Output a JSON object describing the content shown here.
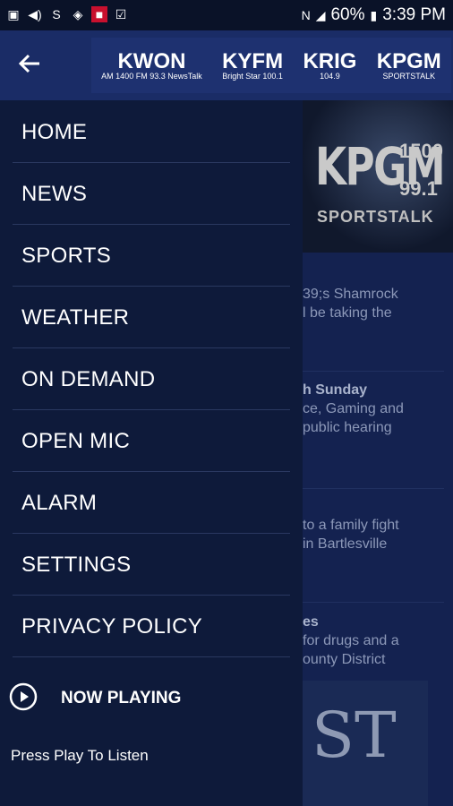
{
  "statusbar": {
    "battery": "60%",
    "time": "3:39 PM"
  },
  "background": {
    "banner": {
      "logo": "KPGM",
      "freq1": "1500",
      "freq2": "99.1",
      "sub": "SPORTSTALK"
    },
    "items": [
      {
        "line1": "39;s Shamrock",
        "line2": "l be taking the"
      },
      {
        "title": "h Sunday",
        "line1": "ce, Gaming and",
        "line2": "public hearing"
      },
      {
        "line1": "to a family fight",
        "line2": "in Bartlesville"
      },
      {
        "title": "es",
        "line1": "for drugs and a",
        "line2": "ounty District"
      }
    ],
    "thumb_text": "ST"
  },
  "appbar": {
    "logos": [
      {
        "big": "KWON",
        "small": "AM 1400 FM 93.3 NewsTalk"
      },
      {
        "big": "KYFM",
        "small": "Bright Star 100.1"
      },
      {
        "big": "KRIG",
        "small": "104.9"
      },
      {
        "big": "KPGM",
        "small": "SPORTSTALK"
      }
    ]
  },
  "menu": {
    "items": [
      {
        "label": "HOME"
      },
      {
        "label": "NEWS"
      },
      {
        "label": "SPORTS"
      },
      {
        "label": "WEATHER"
      },
      {
        "label": "ON DEMAND"
      },
      {
        "label": "OPEN MIC"
      },
      {
        "label": "ALARM"
      },
      {
        "label": "SETTINGS"
      },
      {
        "label": "PRIVACY POLICY"
      }
    ],
    "now_playing_label": "NOW PLAYING",
    "press_play_text": "Press Play To Listen"
  }
}
